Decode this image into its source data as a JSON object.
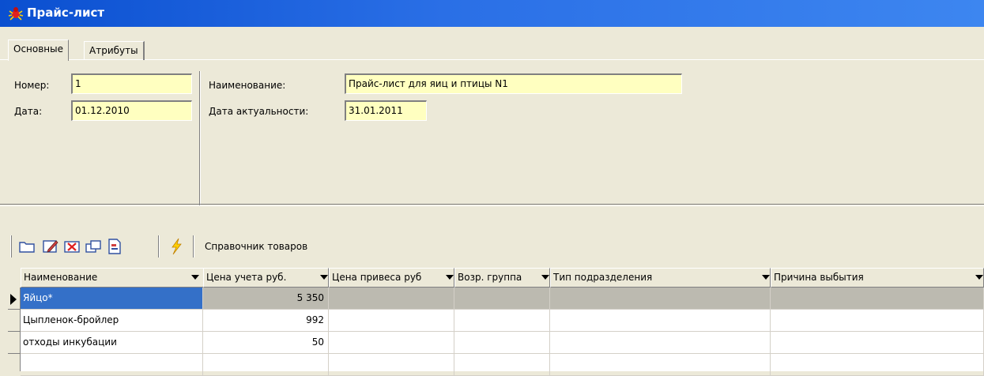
{
  "window": {
    "title": "Прайс-лист",
    "icon": "bug-icon"
  },
  "tabs": [
    {
      "label": "Основные",
      "active": true
    },
    {
      "label": "Атрибуты",
      "active": false
    }
  ],
  "form": {
    "number_label": "Номер:",
    "number_value": "1",
    "date_label": "Дата:",
    "date_value": "01.12.2010",
    "name_label": "Наименование:",
    "name_value": "Прайс-лист для яиц и птицы N1",
    "actual_date_label": "Дата актуальности:",
    "actual_date_value": "31.01.2011"
  },
  "toolbar": {
    "buttons": [
      "folder-icon",
      "edit-icon",
      "delete-icon",
      "copy-icon",
      "document-icon",
      "lightning-icon"
    ],
    "catalog_label": "Справочник товаров"
  },
  "grid": {
    "columns": [
      "Наименование",
      "Цена учета руб.",
      "Цена привеса руб",
      "Возр. группа",
      "Тип подразделения",
      "Причина выбытия"
    ],
    "rows": [
      {
        "name": "Яйцо*",
        "price": "5 350",
        "selected": true
      },
      {
        "name": "Цыпленок-бройлер",
        "price": "992",
        "selected": false
      },
      {
        "name": "отходы инкубации",
        "price": "50",
        "selected": false
      }
    ]
  },
  "colors": {
    "titlebar": "#0a4fd0",
    "field_bg": "#ffffc0",
    "selection": "#3470c8",
    "panel": "#ece9d8"
  }
}
